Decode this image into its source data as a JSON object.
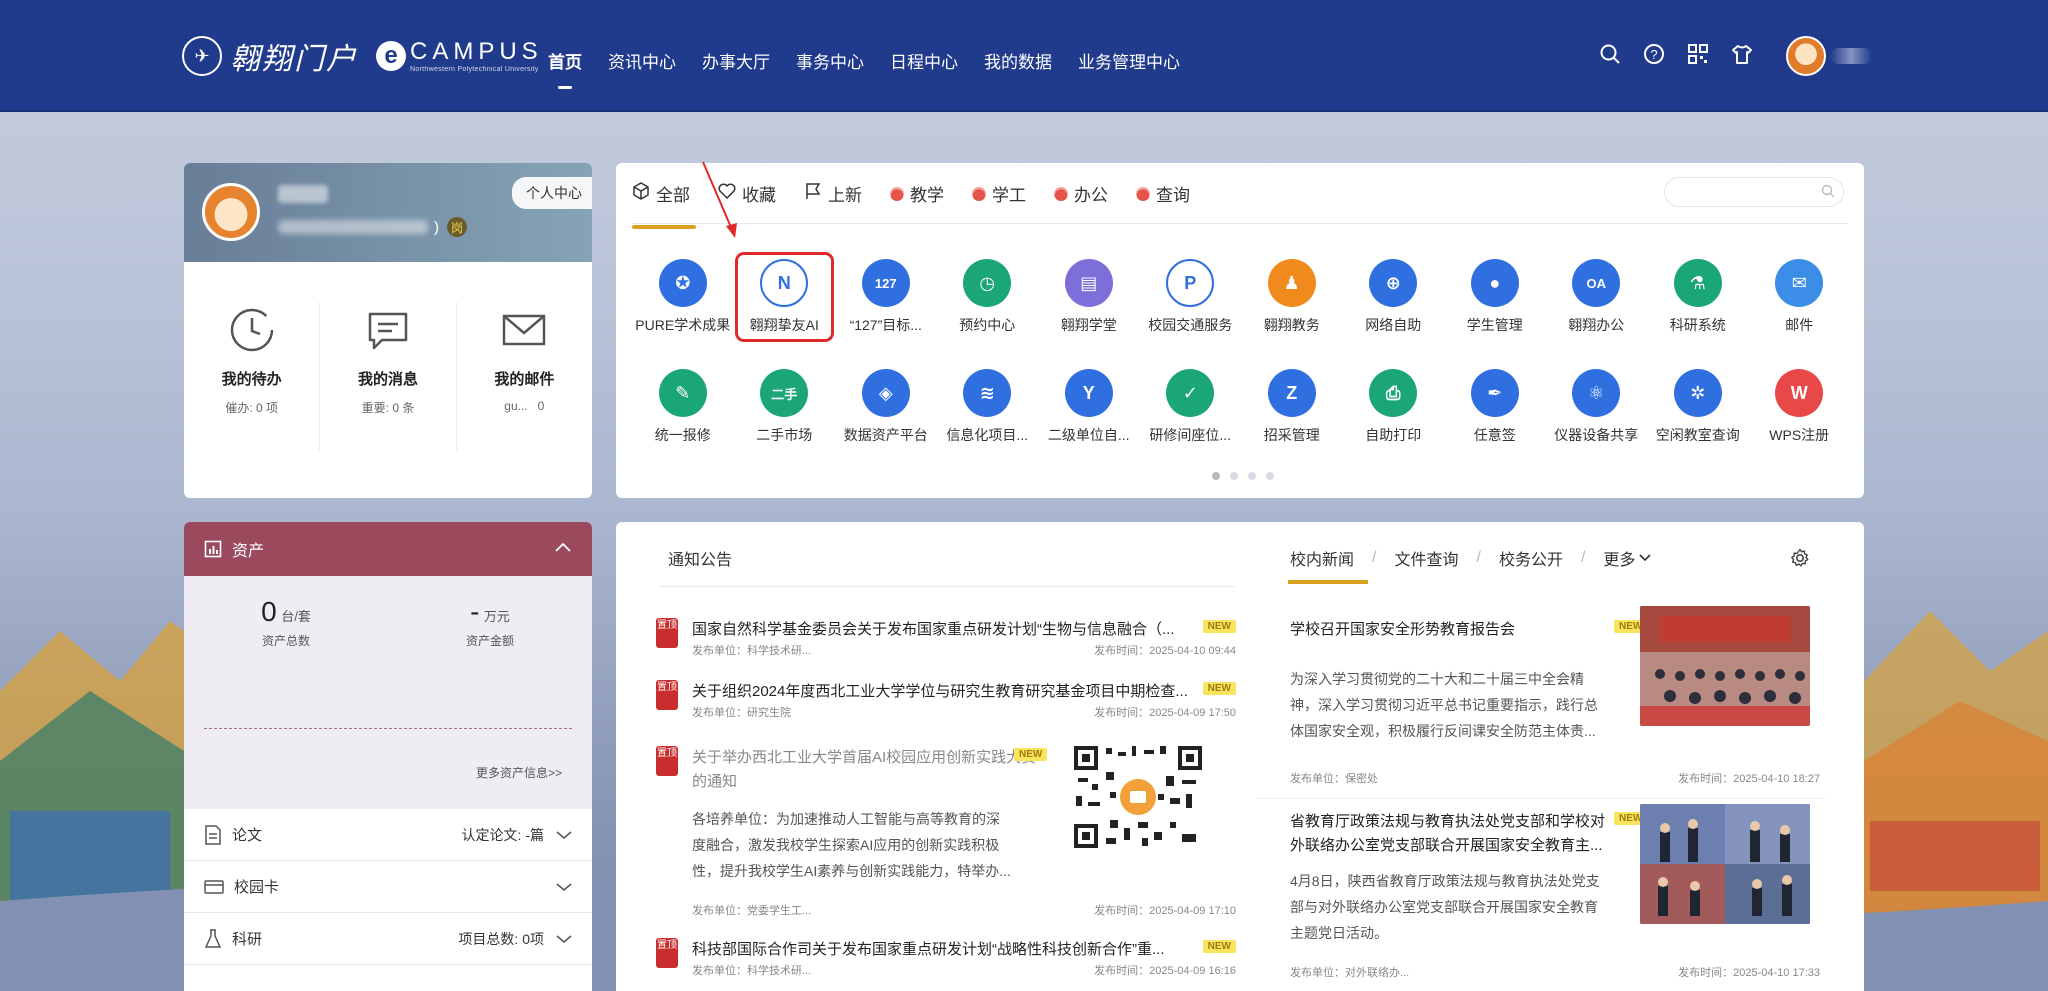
{
  "portal": {
    "name": "翱翔门户",
    "ecampus_title": "CAMPUS",
    "ecampus_sub": "Northwestern Polytechnical University"
  },
  "nav": [
    "首页",
    "资讯中心",
    "办事大厅",
    "事务中心",
    "日程中心",
    "我的数据",
    "业务管理中心"
  ],
  "profile": {
    "center_button": "个人中心",
    "name_suffix": ")",
    "badge": "岗",
    "stats": [
      {
        "title": "我的待办",
        "label": "催办:",
        "value": "0 项"
      },
      {
        "title": "我的消息",
        "label": "重要:",
        "value": "0 条"
      },
      {
        "title": "我的邮件",
        "label": "gu...",
        "value": "0"
      }
    ]
  },
  "asset": {
    "title": "资产",
    "count_value": "0",
    "count_unit": "台/套",
    "count_label": "资产总数",
    "amount_value": "-",
    "amount_unit": "万元",
    "amount_label": "资产金额",
    "more": "更多资产信息>>"
  },
  "accordions": [
    {
      "label": "论文",
      "right": "认定论文: -篇"
    },
    {
      "label": "校园卡",
      "right": ""
    },
    {
      "label": "科研",
      "right": "项目总数: 0项"
    }
  ],
  "app_tabs": [
    "全部",
    "收藏",
    "上新",
    "教学",
    "学工",
    "办公",
    "查询"
  ],
  "apps": [
    {
      "label": "PURE学术成果",
      "color": "#2f6fe0",
      "glyph": "✪"
    },
    {
      "label": "翱翔挚友AI",
      "color": "#ffffff",
      "glyph": "N"
    },
    {
      "label": "“127”目标...",
      "color": "#2f6fe0",
      "glyph": "127"
    },
    {
      "label": "预约中心",
      "color": "#1aa675",
      "glyph": "◷"
    },
    {
      "label": "翱翔学堂",
      "color": "#7d6fd9",
      "glyph": "▤"
    },
    {
      "label": "校园交通服务",
      "color": "#ffffff",
      "glyph": "P"
    },
    {
      "label": "翱翔教务",
      "color": "#f08a1c",
      "glyph": "♟"
    },
    {
      "label": "网络自助",
      "color": "#2f6fe0",
      "glyph": "⊕"
    },
    {
      "label": "学生管理",
      "color": "#2f6fe0",
      "glyph": "●"
    },
    {
      "label": "翱翔办公",
      "color": "#2f6fe0",
      "glyph": "OA"
    },
    {
      "label": "科研系统",
      "color": "#1aa675",
      "glyph": "⚗"
    },
    {
      "label": "邮件",
      "color": "#3b8de8",
      "glyph": "✉"
    },
    {
      "label": "统一报修",
      "color": "#1aa675",
      "glyph": "✎"
    },
    {
      "label": "二手市场",
      "color": "#1aa675",
      "glyph": "二手"
    },
    {
      "label": "数据资产平台",
      "color": "#2f6fe0",
      "glyph": "◈"
    },
    {
      "label": "信息化项目...",
      "color": "#2f6fe0",
      "glyph": "≋"
    },
    {
      "label": "二级单位自...",
      "color": "#2f6fe0",
      "glyph": "Y"
    },
    {
      "label": "研修间座位...",
      "color": "#1aa675",
      "glyph": "✓"
    },
    {
      "label": "招采管理",
      "color": "#2f6fe0",
      "glyph": "Z"
    },
    {
      "label": "自助打印",
      "color": "#1aa675",
      "glyph": "⎙"
    },
    {
      "label": "任意签",
      "color": "#2f6fe0",
      "glyph": "✒"
    },
    {
      "label": "仪器设备共享",
      "color": "#2f6fe0",
      "glyph": "⚛"
    },
    {
      "label": "空闲教室查询",
      "color": "#2f6fe0",
      "glyph": "✲"
    },
    {
      "label": "WPS注册",
      "color": "#e84848",
      "glyph": "W"
    }
  ],
  "notice": {
    "title": "通知公告",
    "seal_text": "置顶",
    "new_tag": "NEW",
    "items": [
      {
        "title": "国家自然科学基金委员会关于发布国家重点研发计划“生物与信息融合（...",
        "unit": "发布单位：科学技术研...",
        "time": "发布时间：2025-04-10 09:44"
      },
      {
        "title": "关于组织2024年度西北工业大学学位与研究生教育研究基金项目中期检查...",
        "unit": "发布单位：研究生院",
        "time": "发布时间：2025-04-09 17:50"
      },
      {
        "title": "关于举办西北工业大学首届AI校园应用创新实践大赛的通知",
        "desc": "各培养单位：为加速推动人工智能与高等教育的深度融合，激发我校学生探索AI应用的创新实践积极性，提升我校学生AI素养与创新实践能力，特举办...",
        "unit": "发布单位：党委学生工...",
        "time": "发布时间：2025-04-09 17:10"
      },
      {
        "title": "科技部国际合作司关于发布国家重点研发计划“战略性科技创新合作”重...",
        "unit": "发布单位：科学技术研...",
        "time": "发布时间：2025-04-09 16:16"
      }
    ]
  },
  "news": {
    "tabs": [
      "校内新闻",
      "文件查询",
      "校务公开",
      "更多"
    ],
    "new_tag": "NEW",
    "items": [
      {
        "title": "学校召开国家安全形势教育报告会",
        "desc": "为深入学习贯彻党的二十大和二十届三中全会精神，深入学习贯彻习近平总书记重要指示，践行总体国家安全观，积极履行反间课安全防范主体责...",
        "unit": "发布单位：保密处",
        "time": "发布时间：2025-04-10 18:27"
      },
      {
        "title": "省教育厅政策法规与教育执法处党支部和学校对外联络办公室党支部联合开展国家安全教育主...",
        "desc": "4月8日，陕西省教育厅政策法规与教育执法处党支部与对外联络办公室党支部联合开展国家安全教育主题党日活动。",
        "unit": "发布单位：对外联络办...",
        "time": "发布时间：2025-04-10 17:33"
      }
    ]
  },
  "colors": {
    "topbar": "#213b8c",
    "accent": "#d9a31f",
    "asset_header": "#9a4a5c",
    "highlight": "#e02a2a"
  }
}
